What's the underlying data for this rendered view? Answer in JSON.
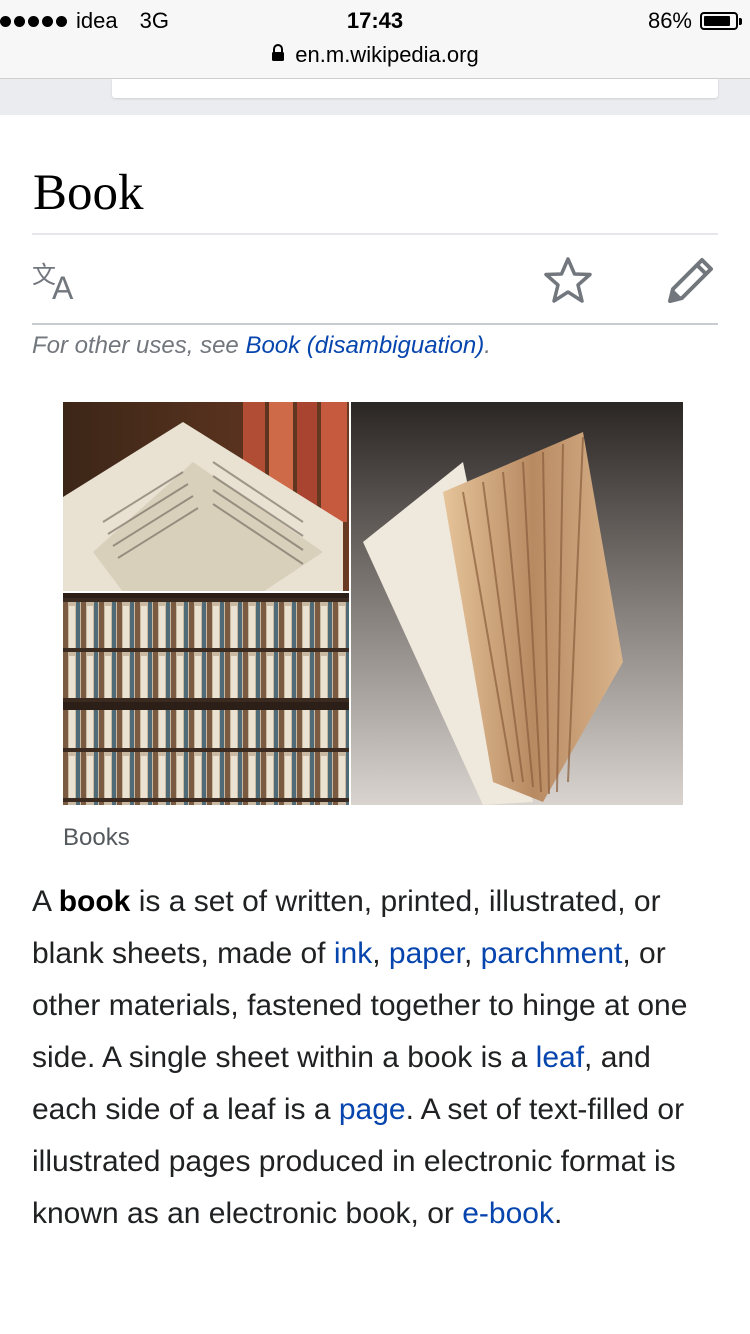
{
  "status_bar": {
    "carrier": "idea",
    "network": "3G",
    "time": "17:43",
    "battery_percent": "86%",
    "battery_level": 0.86
  },
  "url_bar": {
    "url": "en.m.wikipedia.org"
  },
  "article": {
    "title": "Book",
    "hatnote": {
      "prefix": "For other uses, see ",
      "link": "Book (disambiguation)",
      "suffix": "."
    },
    "image_caption": "Books",
    "intro": {
      "s1": "A ",
      "bold": "book",
      "s2": " is a set of written, printed, illustrated, or blank sheets, made of ",
      "link_ink": "ink",
      "s3": ", ",
      "link_paper": "paper",
      "s4": ", ",
      "link_parchment": "parchment",
      "s5": ", or other materials, fastened together to hinge at one side. A single sheet within a book is a ",
      "link_leaf": "leaf",
      "s6": ", and each side of a leaf is a ",
      "link_page": "page",
      "s7": ". A set of text-filled or illustrated pages produced in electronic format is known as an electronic book, or ",
      "link_ebook": "e-book",
      "s8": "."
    }
  },
  "icons": {
    "language": "translate-icon",
    "watch": "star-icon",
    "edit": "pencil-icon",
    "lock": "lock-icon"
  },
  "colors": {
    "link": "#0645ad",
    "text": "#202122",
    "hatnote": "#72777d",
    "icon": "#72777d"
  }
}
